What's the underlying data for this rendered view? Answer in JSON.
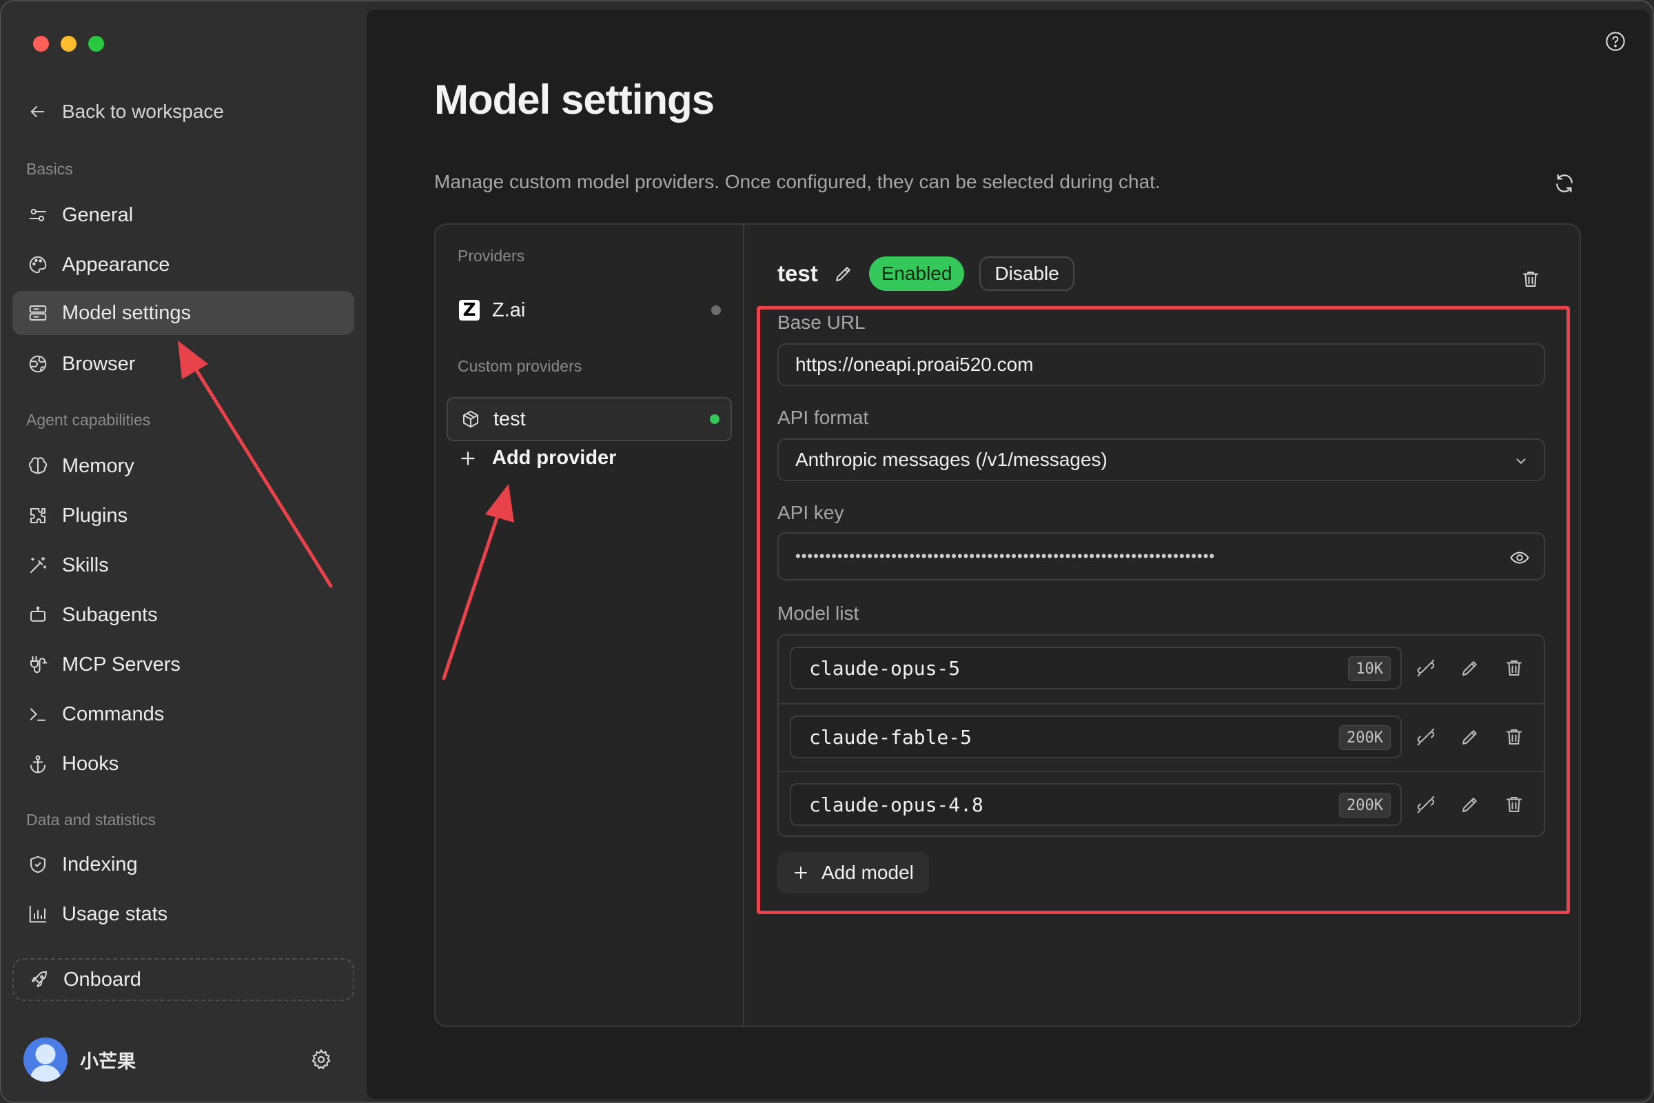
{
  "sidebar": {
    "back_label": "Back to workspace",
    "sections": {
      "basics": "Basics",
      "agent": "Agent capabilities",
      "data": "Data and statistics"
    },
    "items": {
      "general": "General",
      "appearance": "Appearance",
      "model_settings": "Model settings",
      "browser": "Browser",
      "memory": "Memory",
      "plugins": "Plugins",
      "skills": "Skills",
      "subagents": "Subagents",
      "mcp": "MCP Servers",
      "commands": "Commands",
      "hooks": "Hooks",
      "indexing": "Indexing",
      "usage": "Usage stats"
    },
    "onboard_label": "Onboard",
    "user_name": "小芒果"
  },
  "main": {
    "title": "Model settings",
    "subtitle": "Manage custom model providers. Once configured, they can be selected during chat.",
    "providers_label": "Providers",
    "custom_providers_label": "Custom providers",
    "providers": [
      {
        "name": "Z.ai",
        "status": "inactive"
      }
    ],
    "custom_providers": [
      {
        "name": "test",
        "status": "active"
      }
    ],
    "add_provider_label": "Add provider",
    "detail": {
      "name": "test",
      "enabled_label": "Enabled",
      "disable_label": "Disable",
      "base_url_label": "Base URL",
      "base_url_value": "https://oneapi.proai520.com",
      "api_format_label": "API format",
      "api_format_value": "Anthropic messages (/v1/messages)",
      "api_key_label": "API key",
      "api_key_mask": "••••••••••••••••••••••••••••••••••••••••••••••••••••••••••••••••••••••",
      "model_list_label": "Model list",
      "models": [
        {
          "name": "claude-opus-5",
          "context": "10K"
        },
        {
          "name": "claude-fable-5",
          "context": "200K"
        },
        {
          "name": "claude-opus-4.8",
          "context": "200K"
        }
      ],
      "add_model_label": "Add model"
    }
  },
  "colors": {
    "accent_green": "#34c759",
    "annotation_red": "#e8434a",
    "main_bg": "#1e1e1e",
    "sidebar_bg": "#2f2f2f"
  }
}
